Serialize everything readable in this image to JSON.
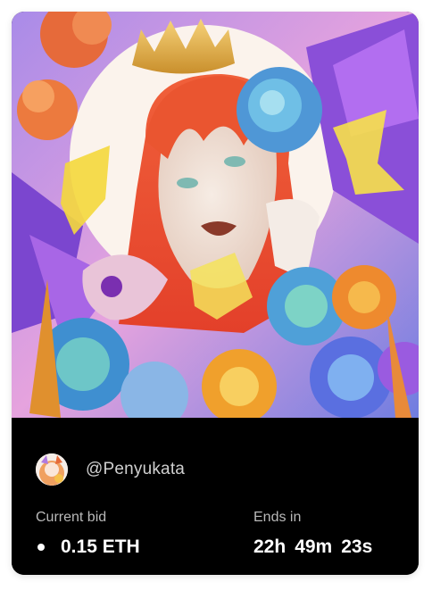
{
  "artwork": {
    "icon": "portrait-artwork-image"
  },
  "creator": {
    "handle": "@Penyukata",
    "avatar_icon": "avatar-image"
  },
  "bid": {
    "label": "Current bid",
    "value": "0.15 ETH"
  },
  "auction": {
    "label": "Ends in",
    "hours": "22h",
    "minutes": "49m",
    "seconds": "23s"
  }
}
